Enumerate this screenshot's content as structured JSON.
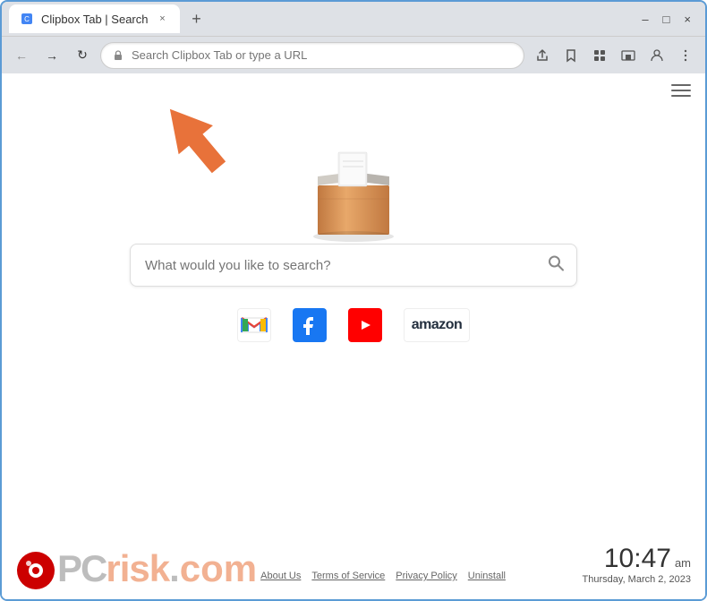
{
  "browser": {
    "tab_favicon": "📋",
    "tab_title": "Clipbox Tab | Search",
    "tab_close": "×",
    "new_tab": "+",
    "window_controls": {
      "minimize": "–",
      "maximize": "□",
      "close": "×"
    },
    "nav": {
      "back": "←",
      "forward": "→",
      "refresh": "↻"
    },
    "address_value": "Search Clipbox Tab or type a URL",
    "toolbar_icons": {
      "share": "⬆",
      "bookmark": "☆",
      "extensions": "🧩",
      "cast": "▭",
      "profile": "👤",
      "menu": "⋮"
    }
  },
  "page": {
    "hamburger_label": "menu",
    "search_placeholder": "What would you like to search?",
    "search_button_label": "Search",
    "quick_links": [
      {
        "id": "gmail",
        "label": "Gmail",
        "color": "#fff",
        "text": "M"
      },
      {
        "id": "facebook",
        "label": "Facebook",
        "color": "#1877f2",
        "text": "f"
      },
      {
        "id": "youtube",
        "label": "YouTube",
        "color": "#ff0000",
        "text": "▶"
      },
      {
        "id": "amazon",
        "label": "amazon",
        "color": "#fff",
        "text": "amazon"
      }
    ]
  },
  "footer": {
    "site_name_pc": "PC",
    "site_domain": "risk.com",
    "links": [
      {
        "id": "about",
        "label": "About Us"
      },
      {
        "id": "tos",
        "label": "Terms of Service"
      },
      {
        "id": "privacy",
        "label": "Privacy Policy"
      },
      {
        "id": "uninstall",
        "label": "Uninstall"
      }
    ]
  },
  "clock": {
    "time": "10:47",
    "ampm": "am",
    "date": "Thursday, March 2, 2023"
  }
}
